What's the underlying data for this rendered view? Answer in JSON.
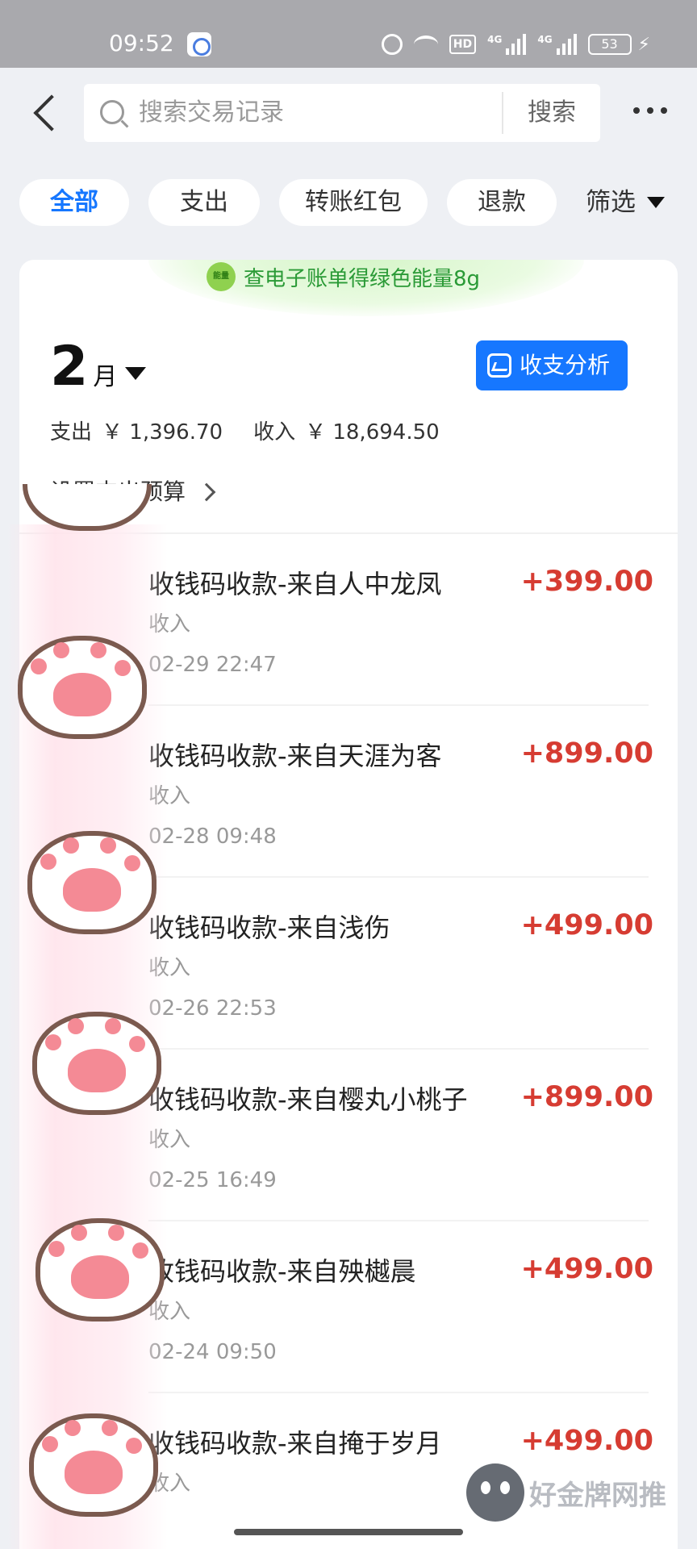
{
  "status_bar": {
    "time": "09:52",
    "hd_label": "HD",
    "net1": "4G",
    "net2": "4G",
    "battery": "53",
    "icons": [
      "app-icon",
      "alarm-icon",
      "wifi-icon",
      "signal-icon",
      "battery-icon",
      "charging-icon"
    ]
  },
  "header": {
    "search_placeholder": "搜索交易记录",
    "search_button": "搜索"
  },
  "filters": {
    "tabs": [
      "全部",
      "支出",
      "转账红包",
      "退款"
    ],
    "active_index": 0,
    "filter_label": "筛选"
  },
  "banner": {
    "icon_text": "能量",
    "text": "查电子账单得绿色能量8g"
  },
  "month": {
    "number": "2",
    "unit": "月",
    "analysis_button": "收支分析"
  },
  "summary": {
    "expense_label": "支出",
    "expense_amount": "￥ 1,396.70",
    "income_label": "收入",
    "income_amount": "￥ 18,694.50"
  },
  "budget_link": "设置支出预算",
  "transactions": [
    {
      "title": "收钱码收款-来自人中龙凤",
      "type": "收入",
      "time": "02-29 22:47",
      "amount": "+399.00"
    },
    {
      "title": "收钱码收款-来自天涯为客",
      "type": "收入",
      "time": "02-28 09:48",
      "amount": "+899.00"
    },
    {
      "title": "收钱码收款-来自浅伤",
      "type": "收入",
      "time": "02-26 22:53",
      "amount": "+499.00"
    },
    {
      "title": "收钱码收款-来自樱丸小桃子",
      "type": "收入",
      "time": "02-25 16:49",
      "amount": "+899.00"
    },
    {
      "title": "收钱码收款-来自殃樾晨",
      "type": "收入",
      "time": "02-24 09:50",
      "amount": "+499.00"
    },
    {
      "title": "收钱码收款-来自掩于岁月",
      "type": "收入",
      "time": "",
      "amount": "+499.00"
    }
  ],
  "watermark": "好金牌网推",
  "colors": {
    "accent": "#1677ff",
    "amount": "#d63c32",
    "energy_green": "#2a9a36",
    "page_bg": "#eef0f4"
  }
}
